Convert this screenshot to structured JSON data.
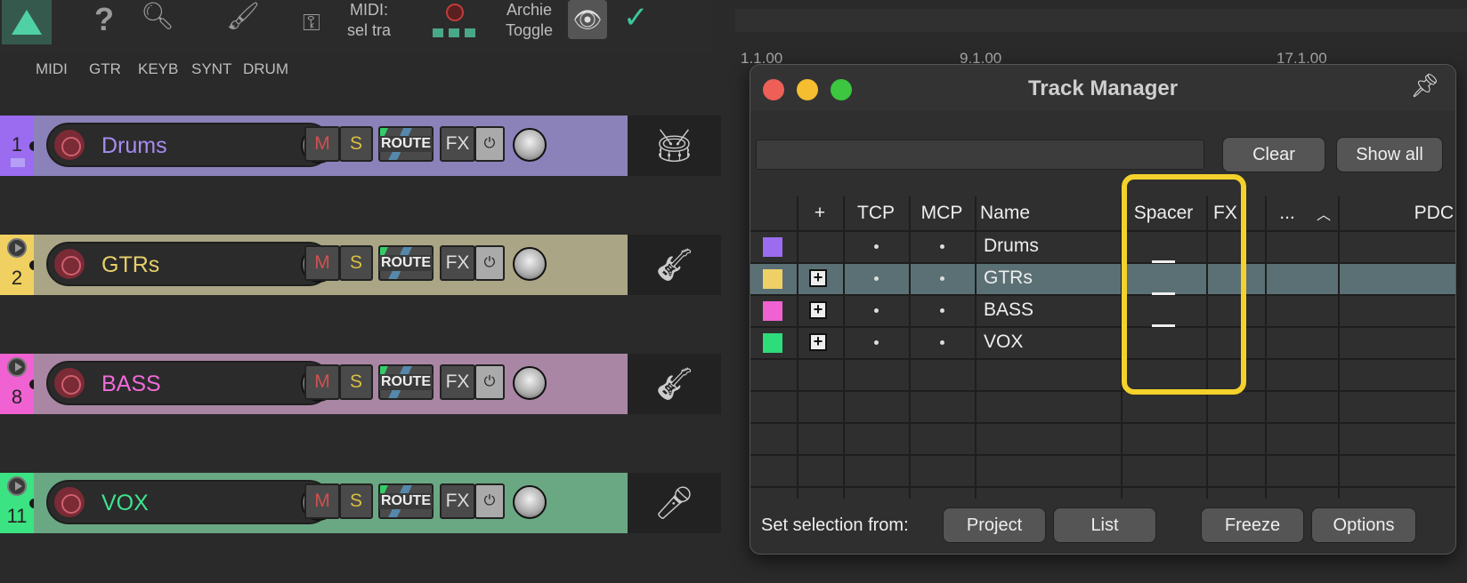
{
  "toolbar": {
    "midi_text_1": "MIDI:",
    "midi_text_2": "sel tra",
    "archie_text_1": "Archie",
    "archie_text_2": "Toggle"
  },
  "folders": [
    "MIDI",
    "GTR",
    "KEYB",
    "SYNT",
    "DRUM"
  ],
  "tracks": [
    {
      "num": "1",
      "name": "Drums",
      "color": "#8a82b8",
      "name_color": "#a78cf0",
      "num_bg": "#9b6cf0",
      "instrument": "drum-kit-icon"
    },
    {
      "num": "2",
      "name": "GTRs",
      "color": "#a9a585",
      "name_color": "#e8cf69",
      "num_bg": "#f0d060",
      "instrument": "electric-guitar-icon"
    },
    {
      "num": "8",
      "name": "BASS",
      "color": "#a986a4",
      "name_color": "#f06ad8",
      "num_bg": "#f062d2",
      "instrument": "bass-guitar-icon"
    },
    {
      "num": "11",
      "name": "VOX",
      "color": "#6aa883",
      "name_color": "#3fe48f",
      "num_bg": "#3be382",
      "instrument": "microphone-icon"
    }
  ],
  "track_buttons": {
    "mute": "M",
    "solo": "S",
    "route": "ROUTE",
    "fx": "FX",
    "power": "⏻"
  },
  "ruler": [
    "1.1.00",
    "9.1.00",
    "17.1.00"
  ],
  "track_manager": {
    "title": "Track Manager",
    "filter_value": "",
    "clear_label": "Clear",
    "show_all_label": "Show all",
    "columns": [
      "+",
      "TCP",
      "MCP",
      "Name",
      "Spacer",
      "FX",
      "...",
      "PDC"
    ],
    "rows": [
      {
        "swatch": "#9b6cf0",
        "plus": false,
        "name": "Drums",
        "spacer": false,
        "selected": false
      },
      {
        "swatch": "#efd067",
        "plus": true,
        "name": "GTRs",
        "spacer": true,
        "selected": true
      },
      {
        "swatch": "#f062d2",
        "plus": true,
        "name": "BASS",
        "spacer": true,
        "selected": false
      },
      {
        "swatch": "#2fdc7c",
        "plus": true,
        "name": "VOX",
        "spacer": true,
        "selected": false
      }
    ],
    "footer_label": "Set selection from:",
    "project_label": "Project",
    "list_label": "List",
    "freeze_label": "Freeze",
    "options_label": "Options"
  },
  "colors": {
    "highlight": "#f4d22b",
    "accent": "#4fd1a5",
    "selected_row": "#5b7075"
  }
}
